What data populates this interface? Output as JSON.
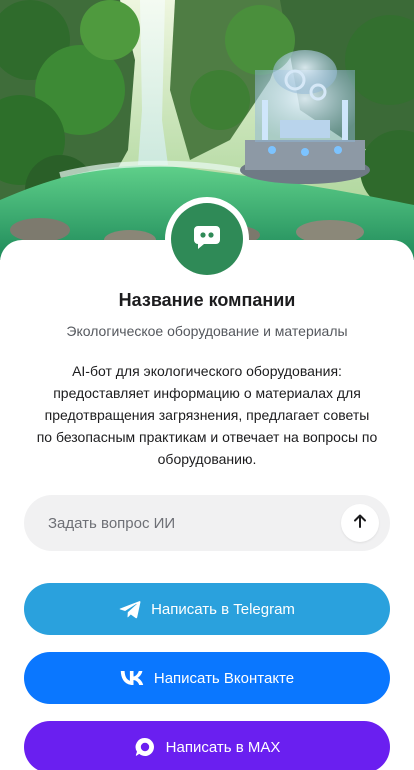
{
  "company": {
    "name": "Название компании",
    "tagline": "Экологическое оборудование и материалы",
    "description": "AI-бот для экологического оборудования: предоставляет информацию о материалах для предотвращения загрязнения, предлагает советы по безопасным практикам и отвечает на вопросы по оборудованию.",
    "avatar_icon": "chat-bot-icon",
    "avatar_color": "#2f8a57"
  },
  "ask": {
    "placeholder": "Задать вопрос ИИ",
    "value": "",
    "send_icon": "arrow-up-icon"
  },
  "buttons": {
    "telegram": {
      "label": "Написать в Telegram",
      "icon": "telegram-icon",
      "color": "#2aa1dd"
    },
    "vk": {
      "label": "Написать Вконтакте",
      "icon": "vk-icon",
      "color": "#0a77ff"
    },
    "max": {
      "label": "Написать в MAX",
      "icon": "max-icon",
      "color": "#6a1ff0"
    }
  }
}
